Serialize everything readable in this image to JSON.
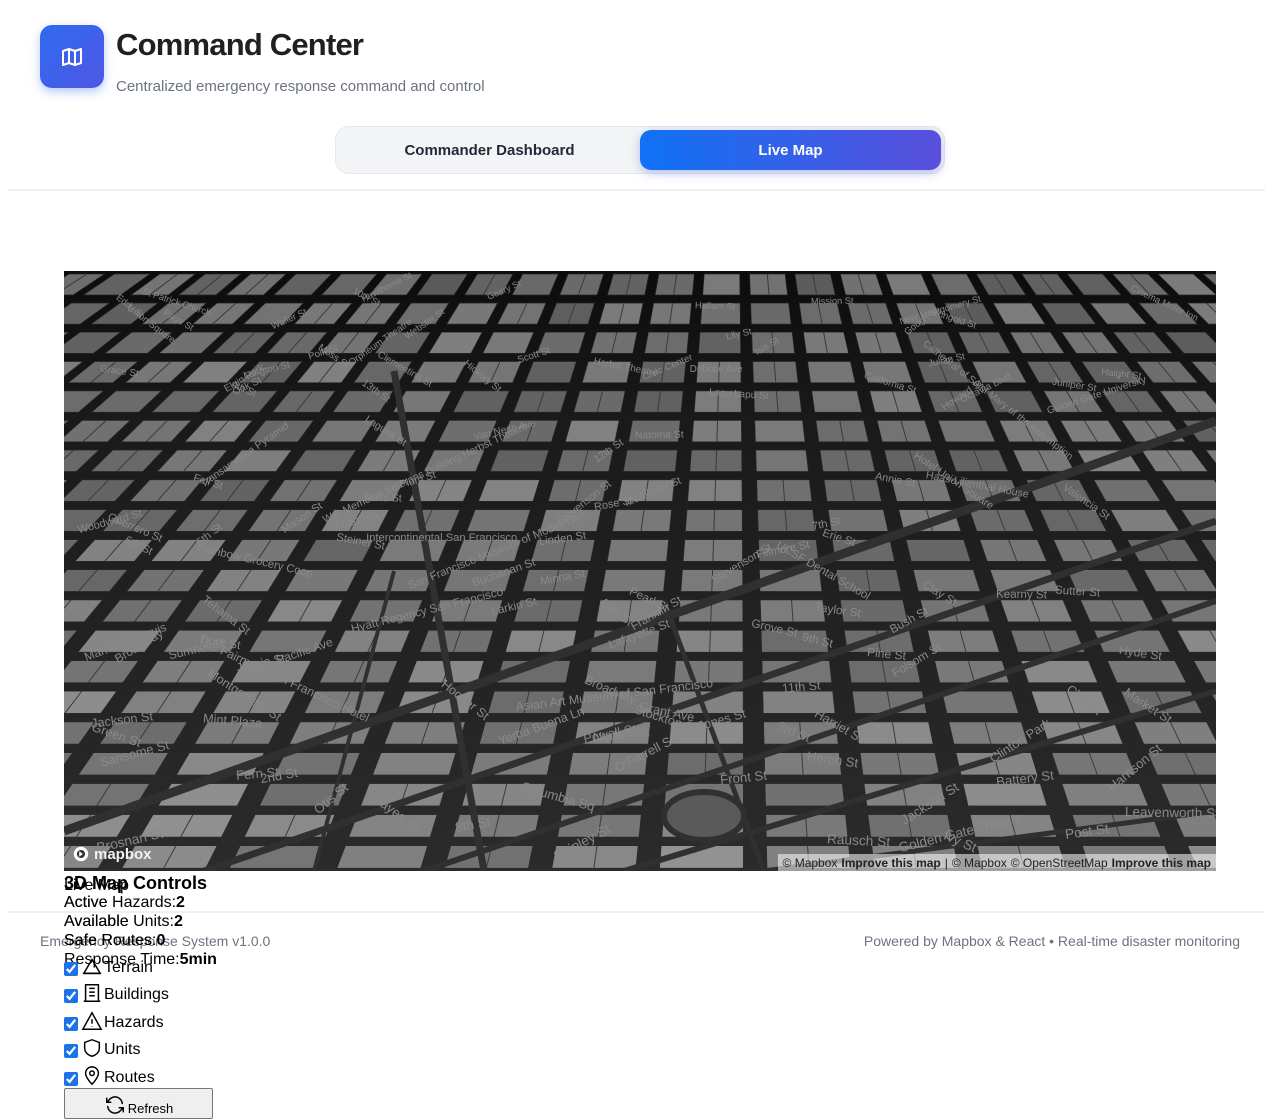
{
  "header": {
    "title": "Command Center",
    "subtitle": "Centralized emergency response command and control",
    "logo_icon": "map-icon"
  },
  "tabs": [
    {
      "label": "Commander Dashboard",
      "active": false
    },
    {
      "label": "Live Map",
      "active": true
    }
  ],
  "map": {
    "logo_text": "mapbox",
    "attribution": {
      "mapbox": "© Mapbox",
      "improve1": "Improve this map",
      "sep": "|",
      "mapbox2": "© Mapbox",
      "osm": "© OpenStreetMap",
      "improve2": "Improve this map"
    },
    "labels": [
      "Broadway",
      "Jackson St",
      "Clay St",
      "Steiner St",
      "Jackson St",
      "Haas-Lilienthal House",
      "California St",
      "Green St",
      "Broadway",
      "Polk St",
      "Hyde St",
      "Pine St",
      "Sutter St",
      "Clay St",
      "Pacific Ave",
      "The Fairmont San Francisco Hotel",
      "Transamerica Pyramid",
      "Front St",
      "Sansome St",
      "Bush St",
      "Hyatt Regency San Francisco",
      "Golden Gate University",
      "Fern St",
      "Geary St",
      "Eddy St",
      "McAllister St",
      "Fulton St",
      "Grove St",
      "Fell St",
      "Page St",
      "Haight St",
      "Waller St",
      "Oak St",
      "Hayes St",
      "Market St",
      "Mission St",
      "Howard St",
      "Folsom St",
      "Harrison St",
      "Octavia Blvd",
      "Gough St",
      "Otis St",
      "Duboce Ave",
      "13th St",
      "Erie St",
      "Plum St",
      "12th St",
      "11th St",
      "10th St",
      "9th St",
      "8th St",
      "7th St",
      "5th St",
      "Guerrero St",
      "Clinton Park",
      "Brosnan St",
      "Valencia St",
      "Woodward St",
      "UCSF Dental School",
      "Webster St",
      "Buchanan St",
      "Laguna St",
      "Asian Art Museum of San Francisco",
      "War Memorial Veterans Building Herbst Theatre",
      "Rainbow Grocery Coop",
      "Lafayette St",
      "Julian St",
      "Linden St",
      "Ivy St",
      "Hickory St",
      "Rose St",
      "Lily St",
      "Jessie St",
      "Pearl St",
      "Elgin Park",
      "Columbia Sq",
      "Cathedral of Saint Mary of the Assumption",
      "Fillmore St",
      "Scott St",
      "Franklin St",
      "Van Ness Ave",
      "Larkin St",
      "Leavenworth St",
      "Jones St",
      "Stevenson St",
      "Minna St",
      "Natoma St",
      "Clementina St",
      "Tehama St",
      "Shipley St",
      "Harriet St",
      "Russ St",
      "Lapu Lapu St",
      "Sumner St",
      "Langton St",
      "Moss St",
      "Rausch St",
      "Grace St",
      "Hallam St",
      "Ringold St",
      "Dore St",
      "Juniper St",
      "Isis St",
      "Heron St",
      "Norfolk St",
      "Stevenson St",
      "Cinema Motor Inn",
      "Civic Center",
      "Herbst Theatre",
      "Intercontinental San Francisco",
      "San Francisco Museum of Modern Art",
      "Marriott Marquis",
      "Hotel Union Square",
      "St Patrick Church",
      "Orpheum Theatre",
      "Golden Gate Theatre",
      "Union Square",
      "Powell St",
      "Ellis St",
      "O'Farrell St",
      "Post St",
      "Mason St",
      "Taylor St",
      "Battery St",
      "Montgomery St",
      "Kearny St",
      "Grant Ave",
      "Stockton St",
      "Hawthorne St",
      "2nd St",
      "3rd St",
      "4th St",
      "6th St",
      "New Montgomery St",
      "Annie St",
      "Yerba Buena Ln",
      "Mint Plaza",
      "Hooper St"
    ]
  },
  "controls": {
    "overlay_title_a": "3D Map Controls",
    "overlay_title_b": "Live Map",
    "stats": {
      "hazards_label": "Active Hazards:",
      "hazards_value": "2",
      "units_label": "Available Units:",
      "units_value": "2",
      "routes_label": "Safe Routes:",
      "routes_value": "0",
      "response_label": "Response Time:",
      "response_value": "5min"
    },
    "ghost_labels": {
      "l1": "Active",
      "l2": "Available",
      "l3": "Safe Routes"
    },
    "layers": [
      {
        "label": "Terrain",
        "icon": "terrain-icon",
        "checked": true
      },
      {
        "label": "Buildings",
        "icon": "building-icon",
        "checked": true
      },
      {
        "label": "Hazards",
        "icon": "warning-icon",
        "checked": true
      },
      {
        "label": "Units",
        "icon": "shield-icon",
        "checked": true
      },
      {
        "label": "Routes",
        "icon": "map-pin-icon",
        "checked": true
      }
    ],
    "refresh_label": "Refresh",
    "refresh_icon": "refresh-icon"
  },
  "footer": {
    "left": "Emergency Response System v1.0.0",
    "right": "Powered by Mapbox & React • Real-time disaster monitoring"
  },
  "colors": {
    "accent_start": "#0f72f5",
    "accent_end": "#5a4fdc",
    "logo": "#2f6bf0",
    "map_bg": "#151515",
    "building": "#8a8a8a",
    "street": "#303030"
  }
}
